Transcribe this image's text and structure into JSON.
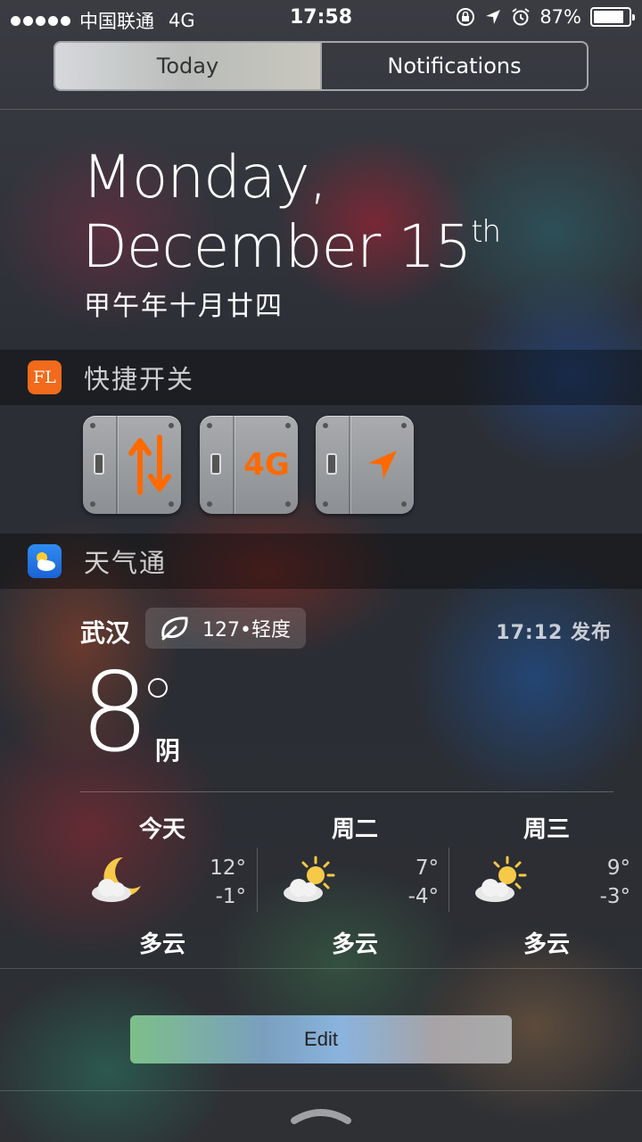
{
  "status_bar": {
    "carrier": "中国联通",
    "network": "4G",
    "time": "17:58",
    "battery": "87%",
    "battery_level": 0.87
  },
  "tabs": {
    "today": "Today",
    "notifications": "Notifications"
  },
  "date": {
    "weekday": "Monday,",
    "month_day": "December 15",
    "ordinal": "th",
    "lunar": "甲午年十月廿四"
  },
  "quick_switch_widget": {
    "title": "快捷开关",
    "icon_text": "FL",
    "switches": [
      {
        "name": "cellular-data",
        "icon": "up-down-arrows-icon"
      },
      {
        "name": "4g",
        "label": "4G"
      },
      {
        "name": "location",
        "icon": "location-arrow-icon"
      }
    ],
    "accent": "#ff6a00"
  },
  "weather_widget": {
    "title": "天气通",
    "city": "武汉",
    "aqi": "127•轻度",
    "published": "17:12 发布",
    "current_temp": "8",
    "condition": "阴",
    "forecast": [
      {
        "day": "今天",
        "high": "12°",
        "low": "-1°",
        "desc": "多云",
        "icon": "cloud-moon-icon"
      },
      {
        "day": "周二",
        "high": "7°",
        "low": "-4°",
        "desc": "多云",
        "icon": "cloud-sun-icon"
      },
      {
        "day": "周三",
        "high": "9°",
        "low": "-3°",
        "desc": "多云",
        "icon": "cloud-sun-icon"
      }
    ]
  },
  "edit_button": "Edit"
}
